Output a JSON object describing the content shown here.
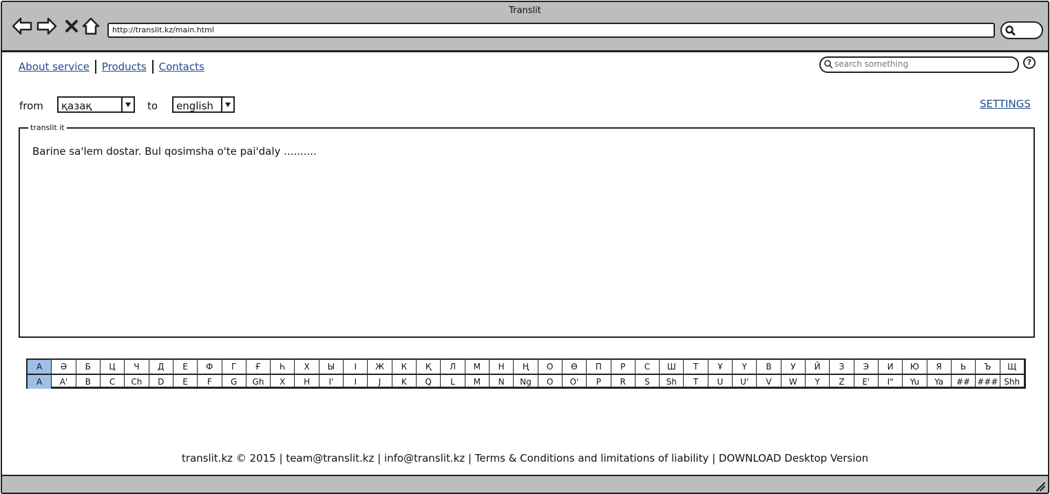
{
  "window": {
    "title": "Translit"
  },
  "browser": {
    "url": "http://translit.kz/main.html"
  },
  "topnav": {
    "about": "About service",
    "products": "Products",
    "contacts": "Contacts"
  },
  "search": {
    "placeholder": "search something"
  },
  "help": {
    "symbol": "?"
  },
  "translate": {
    "from_label": "from",
    "from_value": "қазақ",
    "to_label": "to",
    "to_value": "english",
    "settings": "SETTINGS"
  },
  "panel": {
    "legend": "translit it",
    "text": "Barine sa'lem dostar. Bul qosimsha o'te pai'daly .........."
  },
  "keyboard": {
    "active_index": 0,
    "active_color": "#9fbfe8",
    "cyrillic": [
      "А",
      "Ә",
      "Б",
      "Ц",
      "Ч",
      "Д",
      "Е",
      "Ф",
      "Г",
      "Ғ",
      "Һ",
      "Х",
      "Ы",
      "І",
      "Ж",
      "К",
      "Қ",
      "Л",
      "М",
      "Н",
      "Ң",
      "О",
      "Ө",
      "П",
      "Р",
      "С",
      "Ш",
      "Т",
      "Ұ",
      "Ү",
      "В",
      "У",
      "Й",
      "З",
      "Э",
      "И",
      "Ю",
      "Я",
      "Ь",
      "Ъ",
      "Щ"
    ],
    "latin": [
      "A",
      "A'",
      "B",
      "C",
      "Ch",
      "D",
      "E",
      "F",
      "G",
      "Gh",
      "X",
      "H",
      "I'",
      "I",
      "J",
      "K",
      "Q",
      "L",
      "M",
      "N",
      "Ng",
      "O",
      "O'",
      "P",
      "R",
      "S",
      "Sh",
      "T",
      "U",
      "U'",
      "V",
      "W",
      "Y",
      "Z",
      "E'",
      "I\"",
      "Yu",
      "Ya",
      "##",
      "###",
      "Shh"
    ]
  },
  "footer": {
    "text": "translit.kz © 2015 | team@translit.kz | info@translit.kz | Terms & Conditions and limitations of liability | DOWNLOAD Desktop Version"
  },
  "colors": {
    "chrome": "#bdbdbd",
    "link": "#1e4b8f",
    "border": "#222222"
  }
}
